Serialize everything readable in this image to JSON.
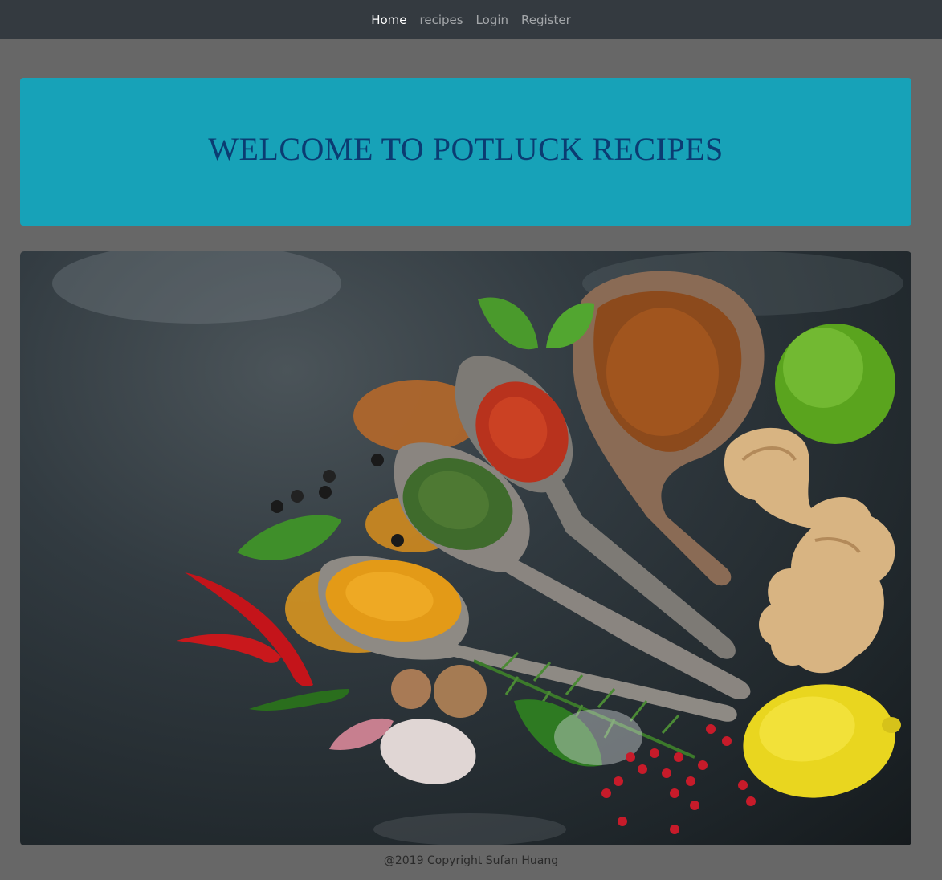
{
  "nav": {
    "items": [
      {
        "label": "Home",
        "active": true
      },
      {
        "label": "recipes",
        "active": false
      },
      {
        "label": "Login",
        "active": false
      },
      {
        "label": "Register",
        "active": false
      }
    ]
  },
  "jumbotron": {
    "title": "WELCOME TO POTLUCK RECIPES"
  },
  "footer": {
    "text": "@2019 Copyright Sufan Huang"
  },
  "colors": {
    "navbar": "#343a40",
    "page_bg": "#676767",
    "jumbotron_bg": "#17a2b8",
    "title_color": "#0b3c72"
  }
}
